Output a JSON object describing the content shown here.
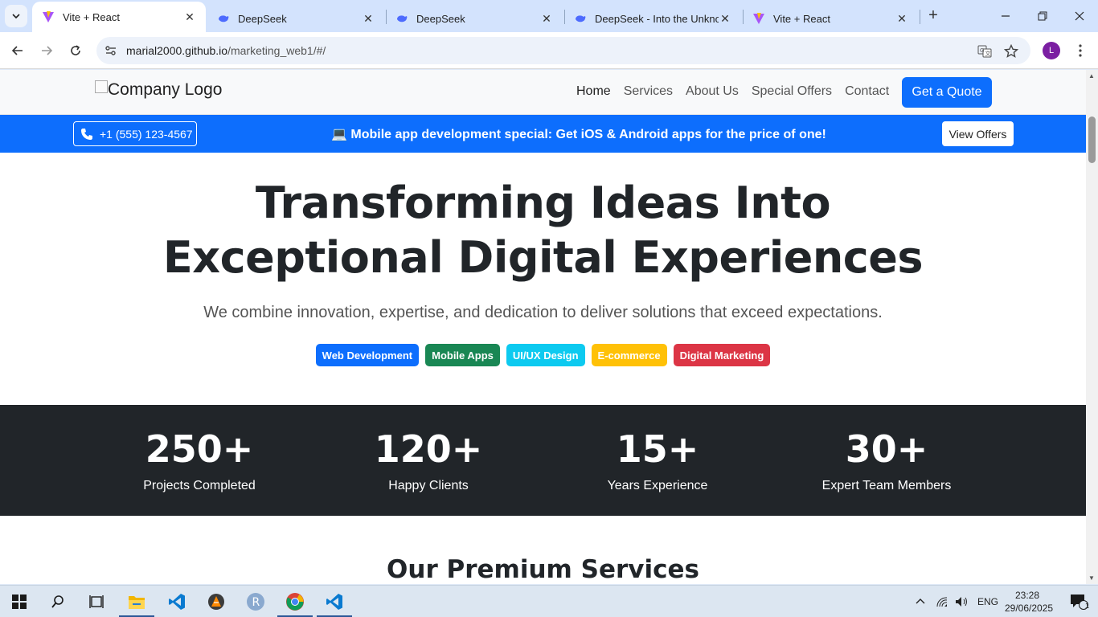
{
  "browser": {
    "tabs": [
      {
        "title": "Vite + React",
        "icon": "vite-icon",
        "active": true
      },
      {
        "title": "DeepSeek",
        "icon": "deepseek-icon",
        "active": false
      },
      {
        "title": "DeepSeek",
        "icon": "deepseek-icon",
        "active": false
      },
      {
        "title": "DeepSeek - Into the Unknow",
        "icon": "deepseek-icon",
        "active": false
      },
      {
        "title": "Vite + React",
        "icon": "vite-icon",
        "active": false
      }
    ],
    "url_host": "marial2000.github.io",
    "url_path": "/marketing_web1/#/",
    "profile_initial": "L"
  },
  "site": {
    "logo_alt": "Company Logo",
    "nav": [
      "Home",
      "Services",
      "About Us",
      "Special Offers",
      "Contact"
    ],
    "cta": "Get a Quote",
    "promo": {
      "phone": "+1 (555) 123-4567",
      "message": "💻 Mobile app development special: Get iOS & Android apps for the price of one!",
      "button": "View Offers"
    },
    "hero": {
      "title_line1": "Transforming Ideas Into",
      "title_line2": "Exceptional Digital Experiences",
      "subtitle": "We combine innovation, expertise, and dedication to deliver solutions that exceed expectations.",
      "badges": [
        {
          "label": "Web Development",
          "color": "#0d6efd"
        },
        {
          "label": "Mobile Apps",
          "color": "#198754"
        },
        {
          "label": "UI/UX Design",
          "color": "#0dcaf0"
        },
        {
          "label": "E-commerce",
          "color": "#ffc107"
        },
        {
          "label": "Digital Marketing",
          "color": "#dc3545"
        }
      ]
    },
    "stats": [
      {
        "value": "250+",
        "label": "Projects Completed"
      },
      {
        "value": "120+",
        "label": "Happy Clients"
      },
      {
        "value": "15+",
        "label": "Years Experience"
      },
      {
        "value": "30+",
        "label": "Expert Team Members"
      }
    ],
    "section_title": "Our Premium Services"
  },
  "taskbar": {
    "language": "ENG",
    "time": "23:28",
    "date": "29/06/2025",
    "notification_count": "1",
    "apps": [
      "start-icon",
      "search-icon",
      "task-view-icon",
      "file-explorer-icon",
      "vscode-icon",
      "vlc-icon",
      "r-icon",
      "chrome-icon",
      "vscode-icon"
    ]
  }
}
